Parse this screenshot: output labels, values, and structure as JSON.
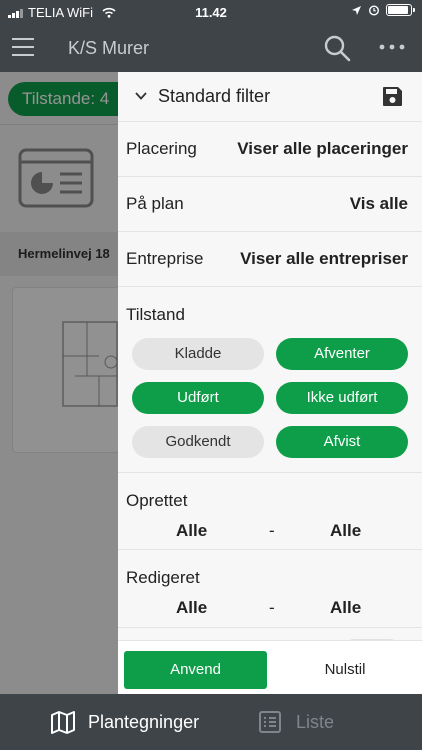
{
  "status_bar": {
    "carrier": "TELIA WiFi",
    "time": "11.42"
  },
  "header": {
    "title": "K/S Murer",
    "icons": [
      "menu-icon",
      "search-icon",
      "more-icon"
    ]
  },
  "background": {
    "tilstande_chip": "Tilstande: 4",
    "address": "Hermelinvej 18"
  },
  "filter": {
    "title": "Standard filter",
    "rows": {
      "placering": {
        "label": "Placering",
        "value": "Viser alle placeringer"
      },
      "paa_plan": {
        "label": "På plan",
        "value": "Vis alle"
      },
      "entreprise": {
        "label": "Entreprise",
        "value": "Viser alle entrepriser"
      }
    },
    "tilstand": {
      "label": "Tilstand",
      "chips": [
        {
          "label": "Kladde",
          "selected": false
        },
        {
          "label": "Afventer",
          "selected": true
        },
        {
          "label": "Udført",
          "selected": true
        },
        {
          "label": "Ikke udført",
          "selected": true
        },
        {
          "label": "Godkendt",
          "selected": false
        },
        {
          "label": "Afvist",
          "selected": true
        }
      ]
    },
    "oprettet": {
      "label": "Oprettet",
      "from": "Alle",
      "separator": "-",
      "to": "Alle"
    },
    "redigeret": {
      "label": "Redigeret",
      "from": "Alle",
      "separator": "-",
      "to": "Alle"
    },
    "actions": {
      "apply": "Anvend",
      "reset": "Nulstil"
    }
  },
  "tab_bar": {
    "tabs": [
      {
        "label": "Plantegninger",
        "active": true
      },
      {
        "label": "Liste",
        "active": false
      }
    ]
  },
  "colors": {
    "accent_green": "#0e9e49",
    "header_dark": "#3f4449",
    "chip_grey": "#e4e4e4"
  }
}
